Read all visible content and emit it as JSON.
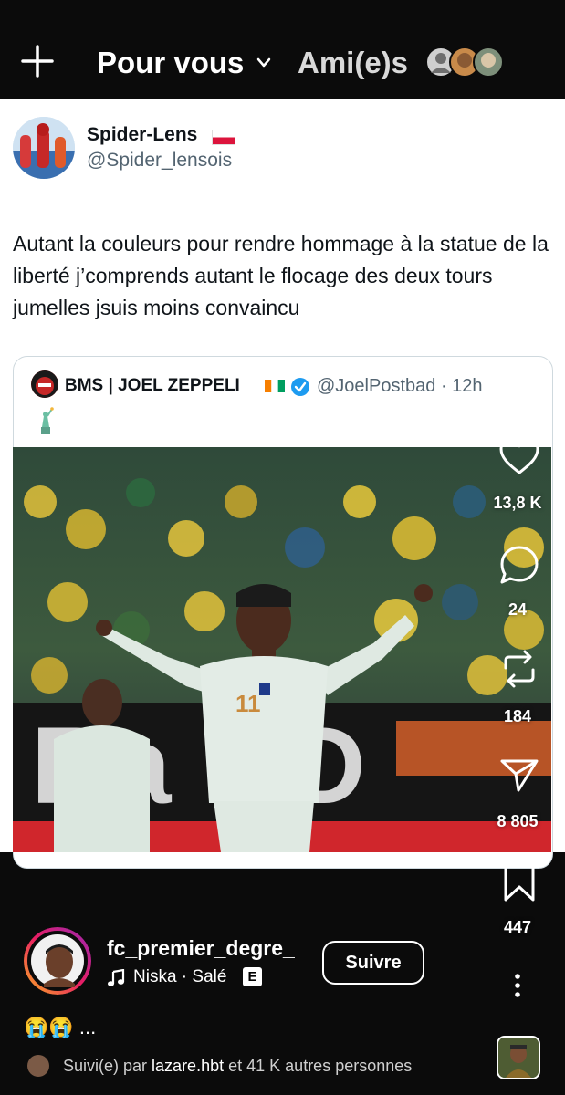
{
  "top_bar": {
    "tab_for_you": "Pour vous",
    "tab_friends": "Ami(e)s"
  },
  "tweet": {
    "author_name": "Spider-Lens",
    "author_handle": "@Spider_lensois",
    "text": "Autant la couleurs pour rendre hommage à la statue de la liberté j’comprends autant le flocage des deux tours jumelles jsuis moins convaincu",
    "quoted": {
      "author_name": "BMS | JOEL ZEPPELI",
      "handle_time": "@JoelPostbad · 12h"
    }
  },
  "actions": {
    "likes": "13,8 K",
    "comments": "24",
    "reposts": "184",
    "shares": "8 805",
    "saves": "447"
  },
  "post": {
    "username": "fc_premier_degre_",
    "music": "Niska · Salé",
    "explicit_badge": "E",
    "follow_label": "Suivre",
    "caption": "😭😭 ...",
    "followed_prefix": "Suivi(e) par",
    "followed_user": "lazare.hbt",
    "followed_suffix": "et 41 K autres personnes"
  },
  "icons": [
    "plus-icon",
    "chevron-down-icon",
    "heart-icon",
    "comment-icon",
    "repost-icon",
    "share-icon",
    "bookmark-icon",
    "music-note-icon",
    "more-vertical-icon",
    "verified-badge-icon",
    "statue-of-liberty-icon"
  ],
  "colors": {
    "background": "#0b0b0b",
    "card": "#ffffff",
    "verified": "#1d9bf0",
    "handle": "#536471"
  }
}
